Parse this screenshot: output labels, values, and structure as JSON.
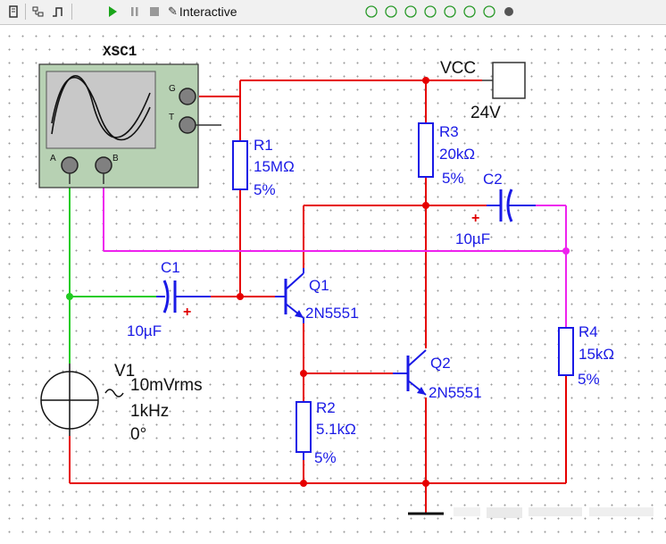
{
  "toolbar": {
    "mode_label": "Interactive",
    "icons": [
      "component-icon",
      "probe-icon",
      "graph-icon",
      "play-icon",
      "pause-icon",
      "stop-icon",
      "wrench-icon",
      "sim-tool-icons",
      "settings-icon"
    ]
  },
  "colors": {
    "wire_red": "#e60000",
    "wire_green": "#22cc22",
    "wire_magenta": "#ee22ee",
    "component_blue": "#1a1ae6",
    "scope_body": "#b7d1b3",
    "scope_screen": "#c8c8c8"
  },
  "schematic": {
    "scope": {
      "ref": "XSC1",
      "pin_g": "G",
      "pin_t": "T",
      "pin_a": "A",
      "pin_b": "B"
    },
    "vcc": {
      "name": "VCC",
      "value": "24V"
    },
    "r1": {
      "ref": "R1",
      "value": "15MΩ",
      "tol": "5%"
    },
    "r2": {
      "ref": "R2",
      "value": "5.1kΩ",
      "tol": "5%"
    },
    "r3": {
      "ref": "R3",
      "value": "20kΩ",
      "tol": "5%"
    },
    "r4": {
      "ref": "R4",
      "value": "15kΩ",
      "tol": "5%"
    },
    "c1": {
      "ref": "C1",
      "value": "10µF",
      "polarity": "+"
    },
    "c2": {
      "ref": "C2",
      "value": "10µF",
      "polarity": "+"
    },
    "q1": {
      "ref": "Q1",
      "model": "2N5551"
    },
    "q2": {
      "ref": "Q2",
      "model": "2N5551"
    },
    "v1": {
      "ref": "V1",
      "amplitude": "10mVrms",
      "freq": "1kHz",
      "phase": "0°"
    }
  }
}
